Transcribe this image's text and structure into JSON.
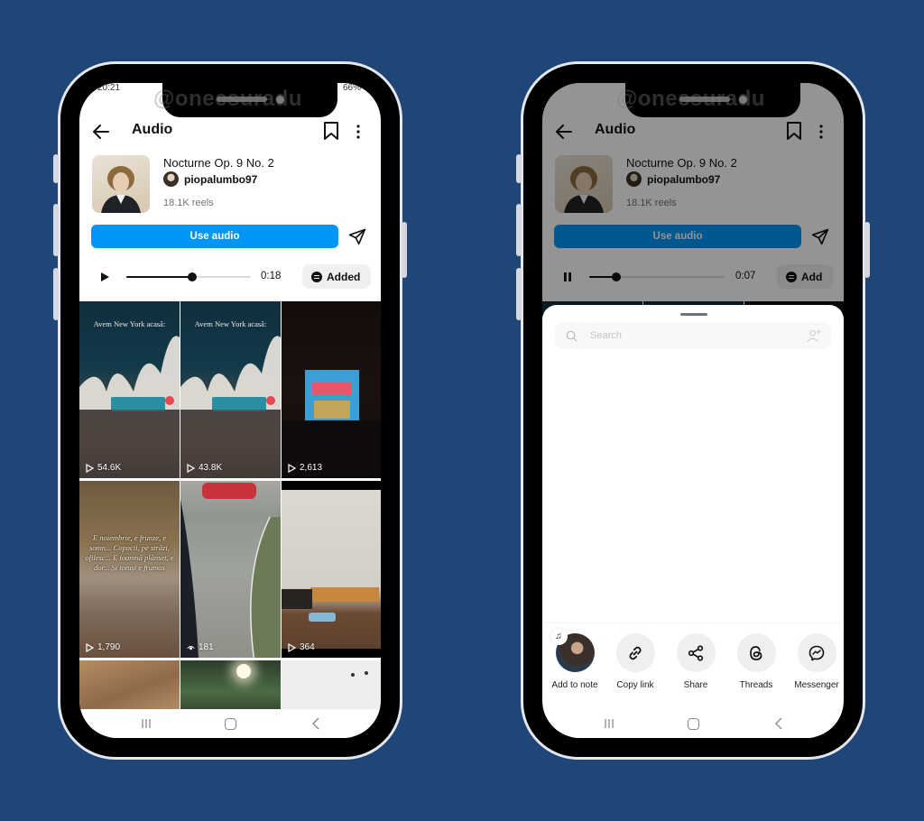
{
  "watermark": "@onecsuradu",
  "phones": [
    {
      "status": {
        "time": "20:21",
        "battery": "66%"
      },
      "header": {
        "title": "Audio"
      },
      "track": {
        "title": "Nocturne Op. 9 No. 2",
        "artist": "piopalumbo97",
        "reels_count": "18.1K reels"
      },
      "actions": {
        "use_audio_label": "Use audio"
      },
      "player": {
        "state": "paused",
        "time": "0:18",
        "progress": 0.53,
        "spotify_label": "Added"
      },
      "grid": [
        {
          "caption": "Avem New York acasă:",
          "views": "54.6K",
          "view_icon": "play-icon"
        },
        {
          "caption": "Avem New York acasă:",
          "views": "43.8K",
          "view_icon": "play-icon"
        },
        {
          "caption": "",
          "views": "2,613",
          "view_icon": "play-icon"
        },
        {
          "caption": "E noiembrie, e frunze, e somn... Copacii, pe străzi, ofilesc... E toamnă plânset, e dor... Și totuși e frumos",
          "views": "1,790",
          "view_icon": "play-icon"
        },
        {
          "caption": "",
          "views": "181",
          "view_icon": "eye-icon"
        },
        {
          "caption": "",
          "views": "364",
          "view_icon": "play-icon"
        },
        {
          "caption": "",
          "views": "",
          "view_icon": ""
        },
        {
          "caption": "",
          "views": "",
          "view_icon": ""
        },
        {
          "caption": "",
          "views": "",
          "view_icon": ""
        }
      ]
    },
    {
      "header": {
        "title": "Audio"
      },
      "track": {
        "title": "Nocturne Op. 9 No. 2",
        "artist": "piopalumbo97",
        "reels_count": "18.1K reels"
      },
      "actions": {
        "use_audio_label": "Use audio"
      },
      "player": {
        "state": "playing",
        "time": "0:07",
        "progress": 0.2,
        "spotify_label": "Add"
      },
      "share_sheet": {
        "search_placeholder": "Search",
        "options": [
          {
            "label": "Add to note",
            "icon": "note-avatar"
          },
          {
            "label": "Copy link",
            "icon": "link-icon"
          },
          {
            "label": "Share",
            "icon": "share-icon"
          },
          {
            "label": "Threads",
            "icon": "threads-icon"
          },
          {
            "label": "Messenger",
            "icon": "messenger-icon"
          }
        ]
      }
    }
  ],
  "colors": {
    "background": "#1f4677",
    "accent": "#0095f6"
  }
}
